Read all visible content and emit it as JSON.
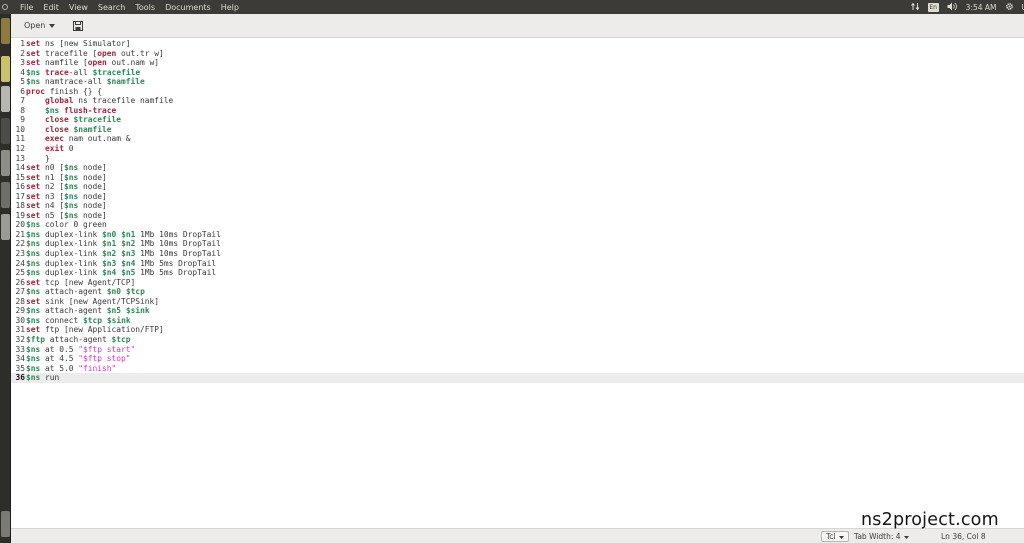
{
  "menubar": {
    "items": [
      "File",
      "Edit",
      "View",
      "Search",
      "Tools",
      "Documents",
      "Help"
    ]
  },
  "indicators": {
    "keyboard_layout": "En",
    "time": "3:54 AM",
    "user_initial": "U"
  },
  "toolbar": {
    "open_label": "Open"
  },
  "editor": {
    "current_line": 36,
    "lines": [
      [
        [
          "kw",
          "set"
        ],
        [
          "plain",
          " ns [new Simulator]"
        ]
      ],
      [
        [
          "kw",
          "set"
        ],
        [
          "plain",
          " tracefile ["
        ],
        [
          "kw",
          "open"
        ],
        [
          "plain",
          " out.tr w]"
        ]
      ],
      [
        [
          "kw",
          "set"
        ],
        [
          "plain",
          " namfile ["
        ],
        [
          "kw",
          "open"
        ],
        [
          "plain",
          " out.nam w]"
        ]
      ],
      [
        [
          "var",
          "$ns"
        ],
        [
          "plain",
          " "
        ],
        [
          "kw",
          "trace"
        ],
        [
          "plain",
          "-all "
        ],
        [
          "var",
          "$tracefile"
        ]
      ],
      [
        [
          "var",
          "$ns"
        ],
        [
          "plain",
          " namtrace-all "
        ],
        [
          "var",
          "$namfile"
        ]
      ],
      [
        [
          "kw",
          "proc"
        ],
        [
          "plain",
          " finish {} {"
        ]
      ],
      [
        [
          "plain",
          "    "
        ],
        [
          "kw",
          "global"
        ],
        [
          "plain",
          " ns tracefile namfile"
        ]
      ],
      [
        [
          "plain",
          "    "
        ],
        [
          "var",
          "$ns"
        ],
        [
          "plain",
          " "
        ],
        [
          "kw",
          "flush-trace"
        ]
      ],
      [
        [
          "plain",
          "    "
        ],
        [
          "kw",
          "close"
        ],
        [
          "plain",
          " "
        ],
        [
          "var",
          "$tracefile"
        ]
      ],
      [
        [
          "plain",
          "    "
        ],
        [
          "kw",
          "close"
        ],
        [
          "plain",
          " "
        ],
        [
          "var",
          "$namfile"
        ]
      ],
      [
        [
          "plain",
          "    "
        ],
        [
          "kw",
          "exec"
        ],
        [
          "plain",
          " nam out.nam &"
        ]
      ],
      [
        [
          "plain",
          "    "
        ],
        [
          "kw",
          "exit"
        ],
        [
          "plain",
          " 0"
        ]
      ],
      [
        [
          "plain",
          "    }"
        ]
      ],
      [
        [
          "kw",
          "set"
        ],
        [
          "plain",
          " n0 ["
        ],
        [
          "var",
          "$ns"
        ],
        [
          "plain",
          " node]"
        ]
      ],
      [
        [
          "kw",
          "set"
        ],
        [
          "plain",
          " n1 ["
        ],
        [
          "var",
          "$ns"
        ],
        [
          "plain",
          " node]"
        ]
      ],
      [
        [
          "kw",
          "set"
        ],
        [
          "plain",
          " n2 ["
        ],
        [
          "var",
          "$ns"
        ],
        [
          "plain",
          " node]"
        ]
      ],
      [
        [
          "kw",
          "set"
        ],
        [
          "plain",
          " n3 ["
        ],
        [
          "var",
          "$ns"
        ],
        [
          "plain",
          " node]"
        ]
      ],
      [
        [
          "kw",
          "set"
        ],
        [
          "plain",
          " n4 ["
        ],
        [
          "var",
          "$ns"
        ],
        [
          "plain",
          " node]"
        ]
      ],
      [
        [
          "kw",
          "set"
        ],
        [
          "plain",
          " n5 ["
        ],
        [
          "var",
          "$ns"
        ],
        [
          "plain",
          " node]"
        ]
      ],
      [
        [
          "var",
          "$ns"
        ],
        [
          "plain",
          " color 0 green"
        ]
      ],
      [
        [
          "var",
          "$ns"
        ],
        [
          "plain",
          " duplex-link "
        ],
        [
          "var",
          "$n0"
        ],
        [
          "plain",
          " "
        ],
        [
          "var",
          "$n1"
        ],
        [
          "plain",
          " 1Mb 10ms DropTail"
        ]
      ],
      [
        [
          "var",
          "$ns"
        ],
        [
          "plain",
          " duplex-link "
        ],
        [
          "var",
          "$n1"
        ],
        [
          "plain",
          " "
        ],
        [
          "var",
          "$n2"
        ],
        [
          "plain",
          " 1Mb 10ms DropTail"
        ]
      ],
      [
        [
          "var",
          "$ns"
        ],
        [
          "plain",
          " duplex-link "
        ],
        [
          "var",
          "$n2"
        ],
        [
          "plain",
          " "
        ],
        [
          "var",
          "$n3"
        ],
        [
          "plain",
          " 1Mb 10ms DropTail"
        ]
      ],
      [
        [
          "var",
          "$ns"
        ],
        [
          "plain",
          " duplex-link "
        ],
        [
          "var",
          "$n3"
        ],
        [
          "plain",
          " "
        ],
        [
          "var",
          "$n4"
        ],
        [
          "plain",
          " 1Mb 5ms DropTail"
        ]
      ],
      [
        [
          "var",
          "$ns"
        ],
        [
          "plain",
          " duplex-link "
        ],
        [
          "var",
          "$n4"
        ],
        [
          "plain",
          " "
        ],
        [
          "var",
          "$n5"
        ],
        [
          "plain",
          " 1Mb 5ms DropTail"
        ]
      ],
      [
        [
          "kw",
          "set"
        ],
        [
          "plain",
          " tcp [new Agent/TCP]"
        ]
      ],
      [
        [
          "var",
          "$ns"
        ],
        [
          "plain",
          " attach-agent "
        ],
        [
          "var",
          "$n0"
        ],
        [
          "plain",
          " "
        ],
        [
          "var",
          "$tcp"
        ]
      ],
      [
        [
          "kw",
          "set"
        ],
        [
          "plain",
          " sink [new Agent/TCPSink]"
        ]
      ],
      [
        [
          "var",
          "$ns"
        ],
        [
          "plain",
          " attach-agent "
        ],
        [
          "var",
          "$n5"
        ],
        [
          "plain",
          " "
        ],
        [
          "var",
          "$sink"
        ]
      ],
      [
        [
          "var",
          "$ns"
        ],
        [
          "plain",
          " connect "
        ],
        [
          "var",
          "$tcp"
        ],
        [
          "plain",
          " "
        ],
        [
          "var",
          "$sink"
        ]
      ],
      [
        [
          "kw",
          "set"
        ],
        [
          "plain",
          " ftp [new Application/FTP]"
        ]
      ],
      [
        [
          "var",
          "$ftp"
        ],
        [
          "plain",
          " attach-agent "
        ],
        [
          "var",
          "$tcp"
        ]
      ],
      [
        [
          "var",
          "$ns"
        ],
        [
          "plain",
          " at 0.5 "
        ],
        [
          "str",
          "\"$ftp start\""
        ]
      ],
      [
        [
          "var",
          "$ns"
        ],
        [
          "plain",
          " at 4.5 "
        ],
        [
          "str",
          "\"$ftp stop\""
        ]
      ],
      [
        [
          "var",
          "$ns"
        ],
        [
          "plain",
          " at 5.0 "
        ],
        [
          "str",
          "\"finish\""
        ]
      ],
      [
        [
          "var",
          "$ns"
        ],
        [
          "plain",
          " run"
        ]
      ]
    ]
  },
  "statusbar": {
    "language": "Tcl",
    "tab_width": "Tab Width: 4",
    "cursor_position": "Ln 36, Col 8"
  },
  "watermark": {
    "text": "ns2project.com"
  },
  "colors": {
    "keyword": "#a6223a",
    "variable": "#2a8a55",
    "string": "#de34c9",
    "panel": "#3c3b37"
  }
}
